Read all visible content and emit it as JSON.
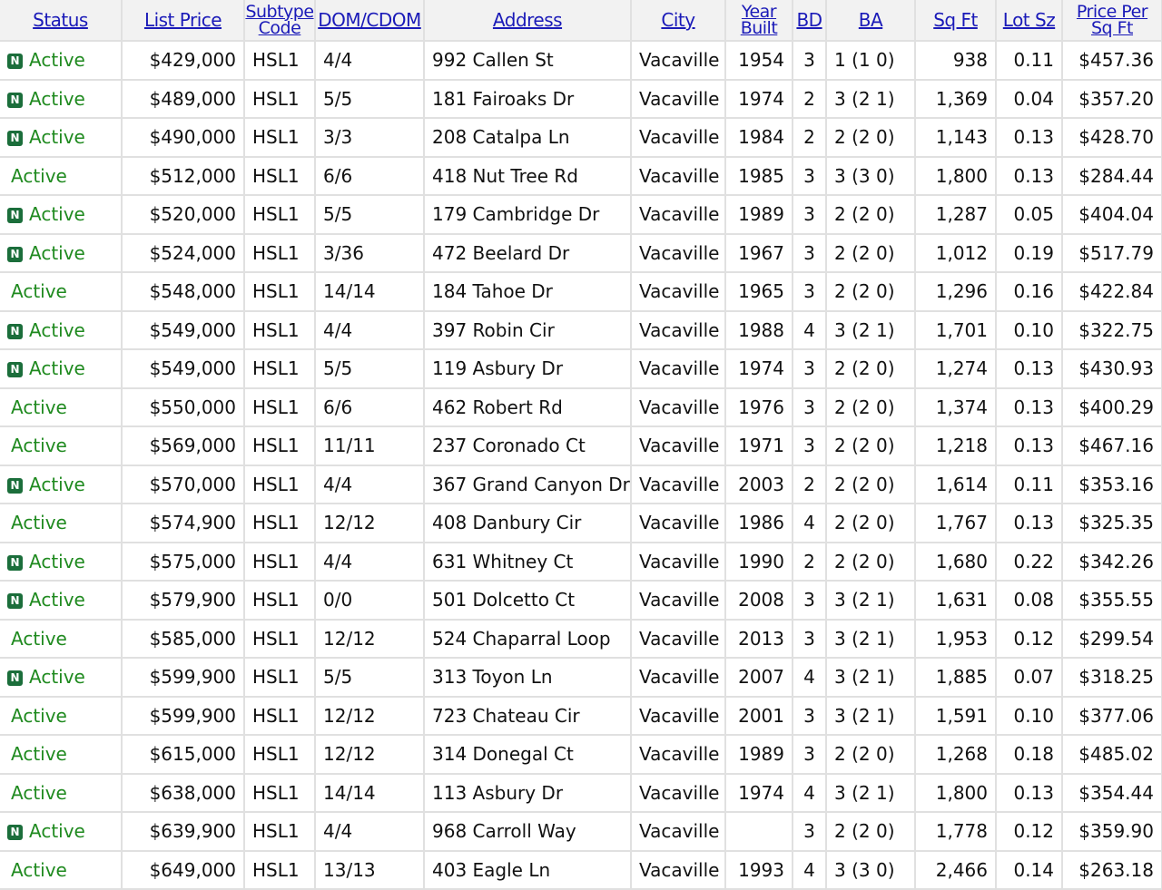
{
  "headers": {
    "status": "Status",
    "list_price": "List Price",
    "subtype_line1": "Subtype",
    "subtype_line2": "Code",
    "dom": "DOM/CDOM",
    "address": "Address",
    "city": "City",
    "year_line1": "Year",
    "year_line2": "Built",
    "bd": "BD",
    "ba": "BA",
    "sqft": "Sq Ft",
    "lot": "Lot Sz",
    "ppsf_line1": "Price Per",
    "ppsf_line2": "Sq Ft"
  },
  "badge_text": "N",
  "colors": {
    "link": "#1a1ab8",
    "status_active": "#1f8a1f",
    "badge_bg": "#1b6e3b",
    "grid": "#e0e0e0",
    "header_bg": "#f2f2f2"
  },
  "rows": [
    {
      "is_new": true,
      "status": "Active",
      "price": "$429,000",
      "subtype": "HSL1",
      "dom": "4/4",
      "address": "992 Callen St",
      "city": "Vacaville",
      "year": "1954",
      "bd": "3",
      "ba": "1 (1 0)",
      "sqft": "938",
      "lot": "0.11",
      "ppsf": "$457.36"
    },
    {
      "is_new": true,
      "status": "Active",
      "price": "$489,000",
      "subtype": "HSL1",
      "dom": "5/5",
      "address": "181 Fairoaks Dr",
      "city": "Vacaville",
      "year": "1974",
      "bd": "2",
      "ba": "3 (2 1)",
      "sqft": "1,369",
      "lot": "0.04",
      "ppsf": "$357.20"
    },
    {
      "is_new": true,
      "status": "Active",
      "price": "$490,000",
      "subtype": "HSL1",
      "dom": "3/3",
      "address": "208 Catalpa Ln",
      "city": "Vacaville",
      "year": "1984",
      "bd": "2",
      "ba": "2 (2 0)",
      "sqft": "1,143",
      "lot": "0.13",
      "ppsf": "$428.70"
    },
    {
      "is_new": false,
      "status": "Active",
      "price": "$512,000",
      "subtype": "HSL1",
      "dom": "6/6",
      "address": "418 Nut Tree Rd",
      "city": "Vacaville",
      "year": "1985",
      "bd": "3",
      "ba": "3 (3 0)",
      "sqft": "1,800",
      "lot": "0.13",
      "ppsf": "$284.44"
    },
    {
      "is_new": true,
      "status": "Active",
      "price": "$520,000",
      "subtype": "HSL1",
      "dom": "5/5",
      "address": "179 Cambridge Dr",
      "city": "Vacaville",
      "year": "1989",
      "bd": "3",
      "ba": "2 (2 0)",
      "sqft": "1,287",
      "lot": "0.05",
      "ppsf": "$404.04"
    },
    {
      "is_new": true,
      "status": "Active",
      "price": "$524,000",
      "subtype": "HSL1",
      "dom": "3/36",
      "address": "472 Beelard Dr",
      "city": "Vacaville",
      "year": "1967",
      "bd": "3",
      "ba": "2 (2 0)",
      "sqft": "1,012",
      "lot": "0.19",
      "ppsf": "$517.79"
    },
    {
      "is_new": false,
      "status": "Active",
      "price": "$548,000",
      "subtype": "HSL1",
      "dom": "14/14",
      "address": "184 Tahoe Dr",
      "city": "Vacaville",
      "year": "1965",
      "bd": "3",
      "ba": "2 (2 0)",
      "sqft": "1,296",
      "lot": "0.16",
      "ppsf": "$422.84"
    },
    {
      "is_new": true,
      "status": "Active",
      "price": "$549,000",
      "subtype": "HSL1",
      "dom": "4/4",
      "address": "397 Robin Cir",
      "city": "Vacaville",
      "year": "1988",
      "bd": "4",
      "ba": "3 (2 1)",
      "sqft": "1,701",
      "lot": "0.10",
      "ppsf": "$322.75"
    },
    {
      "is_new": true,
      "status": "Active",
      "price": "$549,000",
      "subtype": "HSL1",
      "dom": "5/5",
      "address": "119 Asbury Dr",
      "city": "Vacaville",
      "year": "1974",
      "bd": "3",
      "ba": "2 (2 0)",
      "sqft": "1,274",
      "lot": "0.13",
      "ppsf": "$430.93"
    },
    {
      "is_new": false,
      "status": "Active",
      "price": "$550,000",
      "subtype": "HSL1",
      "dom": "6/6",
      "address": "462 Robert Rd",
      "city": "Vacaville",
      "year": "1976",
      "bd": "3",
      "ba": "2 (2 0)",
      "sqft": "1,374",
      "lot": "0.13",
      "ppsf": "$400.29"
    },
    {
      "is_new": false,
      "status": "Active",
      "price": "$569,000",
      "subtype": "HSL1",
      "dom": "11/11",
      "address": "237 Coronado Ct",
      "city": "Vacaville",
      "year": "1971",
      "bd": "3",
      "ba": "2 (2 0)",
      "sqft": "1,218",
      "lot": "0.13",
      "ppsf": "$467.16"
    },
    {
      "is_new": true,
      "status": "Active",
      "price": "$570,000",
      "subtype": "HSL1",
      "dom": "4/4",
      "address": "367 Grand Canyon Dr",
      "city": "Vacaville",
      "year": "2003",
      "bd": "2",
      "ba": "2 (2 0)",
      "sqft": "1,614",
      "lot": "0.11",
      "ppsf": "$353.16"
    },
    {
      "is_new": false,
      "status": "Active",
      "price": "$574,900",
      "subtype": "HSL1",
      "dom": "12/12",
      "address": "408 Danbury Cir",
      "city": "Vacaville",
      "year": "1986",
      "bd": "4",
      "ba": "2 (2 0)",
      "sqft": "1,767",
      "lot": "0.13",
      "ppsf": "$325.35"
    },
    {
      "is_new": true,
      "status": "Active",
      "price": "$575,000",
      "subtype": "HSL1",
      "dom": "4/4",
      "address": "631 Whitney Ct",
      "city": "Vacaville",
      "year": "1990",
      "bd": "2",
      "ba": "2 (2 0)",
      "sqft": "1,680",
      "lot": "0.22",
      "ppsf": "$342.26"
    },
    {
      "is_new": true,
      "status": "Active",
      "price": "$579,900",
      "subtype": "HSL1",
      "dom": "0/0",
      "address": "501 Dolcetto Ct",
      "city": "Vacaville",
      "year": "2008",
      "bd": "3",
      "ba": "3 (2 1)",
      "sqft": "1,631",
      "lot": "0.08",
      "ppsf": "$355.55"
    },
    {
      "is_new": false,
      "status": "Active",
      "price": "$585,000",
      "subtype": "HSL1",
      "dom": "12/12",
      "address": "524 Chaparral Loop",
      "city": "Vacaville",
      "year": "2013",
      "bd": "3",
      "ba": "3 (2 1)",
      "sqft": "1,953",
      "lot": "0.12",
      "ppsf": "$299.54"
    },
    {
      "is_new": true,
      "status": "Active",
      "price": "$599,900",
      "subtype": "HSL1",
      "dom": "5/5",
      "address": "313 Toyon Ln",
      "city": "Vacaville",
      "year": "2007",
      "bd": "4",
      "ba": "3 (2 1)",
      "sqft": "1,885",
      "lot": "0.07",
      "ppsf": "$318.25"
    },
    {
      "is_new": false,
      "status": "Active",
      "price": "$599,900",
      "subtype": "HSL1",
      "dom": "12/12",
      "address": "723 Chateau Cir",
      "city": "Vacaville",
      "year": "2001",
      "bd": "3",
      "ba": "3 (2 1)",
      "sqft": "1,591",
      "lot": "0.10",
      "ppsf": "$377.06"
    },
    {
      "is_new": false,
      "status": "Active",
      "price": "$615,000",
      "subtype": "HSL1",
      "dom": "12/12",
      "address": "314 Donegal Ct",
      "city": "Vacaville",
      "year": "1989",
      "bd": "3",
      "ba": "2 (2 0)",
      "sqft": "1,268",
      "lot": "0.18",
      "ppsf": "$485.02"
    },
    {
      "is_new": false,
      "status": "Active",
      "price": "$638,000",
      "subtype": "HSL1",
      "dom": "14/14",
      "address": "113 Asbury Dr",
      "city": "Vacaville",
      "year": "1974",
      "bd": "4",
      "ba": "3 (2 1)",
      "sqft": "1,800",
      "lot": "0.13",
      "ppsf": "$354.44"
    },
    {
      "is_new": true,
      "status": "Active",
      "price": "$639,900",
      "subtype": "HSL1",
      "dom": "4/4",
      "address": "968 Carroll Way",
      "city": "Vacaville",
      "year": "",
      "bd": "3",
      "ba": "2 (2 0)",
      "sqft": "1,778",
      "lot": "0.12",
      "ppsf": "$359.90"
    },
    {
      "is_new": false,
      "status": "Active",
      "price": "$649,000",
      "subtype": "HSL1",
      "dom": "13/13",
      "address": "403 Eagle Ln",
      "city": "Vacaville",
      "year": "1993",
      "bd": "4",
      "ba": "3 (3 0)",
      "sqft": "2,466",
      "lot": "0.14",
      "ppsf": "$263.18"
    }
  ]
}
